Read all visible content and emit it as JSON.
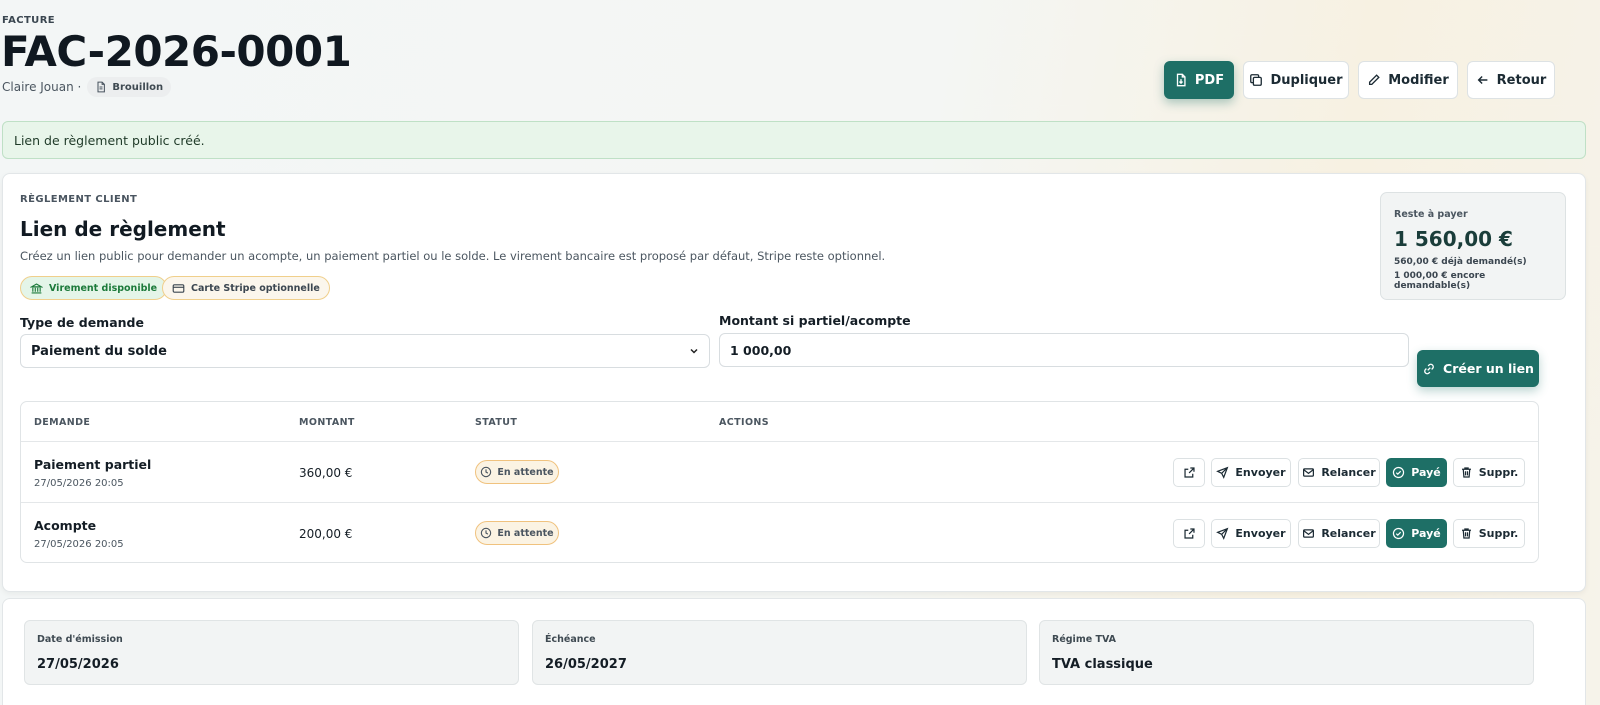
{
  "header": {
    "eyebrow": "FACTURE",
    "title": "FAC-2026-0001",
    "client": "Claire Jouan ·",
    "status": "Brouillon",
    "buttons": {
      "pdf": "PDF",
      "duplicate": "Dupliquer",
      "edit": "Modifier",
      "back": "Retour"
    }
  },
  "alert": "Lien de règlement public créé.",
  "payment": {
    "eyebrow": "RÈGLEMENT CLIENT",
    "title": "Lien de règlement",
    "description": "Créez un lien public pour demander un acompte, un paiement partiel ou le solde. Le virement bancaire est proposé par défaut, Stripe reste optionnel.",
    "tags": {
      "transfer": "Virement disponible",
      "stripe": "Carte Stripe optionnelle"
    },
    "summary": {
      "label": "Reste à payer",
      "amount": "1 560,00 €",
      "requested": "560,00 € déjà demandé(s)",
      "remaining": "1 000,00 € encore demandable(s)"
    },
    "form": {
      "type_label": "Type de demande",
      "type_value": "Paiement du solde",
      "amount_label": "Montant si partiel/acompte",
      "amount_value": "1 000,00",
      "create_button": "Créer un lien"
    },
    "table": {
      "headers": {
        "request": "DEMANDE",
        "amount": "MONTANT",
        "status": "STATUT",
        "actions": "ACTIONS"
      },
      "rows": [
        {
          "title": "Paiement partiel",
          "date": "27/05/2026 20:05",
          "amount": "360,00 €",
          "status": "En attente"
        },
        {
          "title": "Acompte",
          "date": "27/05/2026 20:05",
          "amount": "200,00 €",
          "status": "En attente"
        }
      ],
      "actions": {
        "send": "Envoyer",
        "remind": "Relancer",
        "paid": "Payé",
        "delete": "Suppr."
      }
    }
  },
  "details": {
    "issue_date_label": "Date d'émission",
    "issue_date": "27/05/2026",
    "due_label": "Échéance",
    "due_date": "26/05/2027",
    "vat_label": "Régime TVA",
    "vat_value": "TVA classique"
  },
  "icons": {
    "status": "document-icon",
    "pdf": "file-pdf-icon",
    "duplicate": "copy-icon",
    "edit": "pencil-icon",
    "back": "arrow-left-icon",
    "transfer": "bank-icon",
    "stripe": "credit-card-icon",
    "create": "link-icon",
    "pending": "clock-icon",
    "open": "external-link-icon",
    "send": "send-icon",
    "remind": "mail-icon",
    "paid": "check-circle-icon",
    "delete": "trash-icon"
  },
  "colors": {
    "accent": "#1e6f66",
    "success_bg": "#e8f5ea",
    "pending_border": "#f0c27e"
  }
}
